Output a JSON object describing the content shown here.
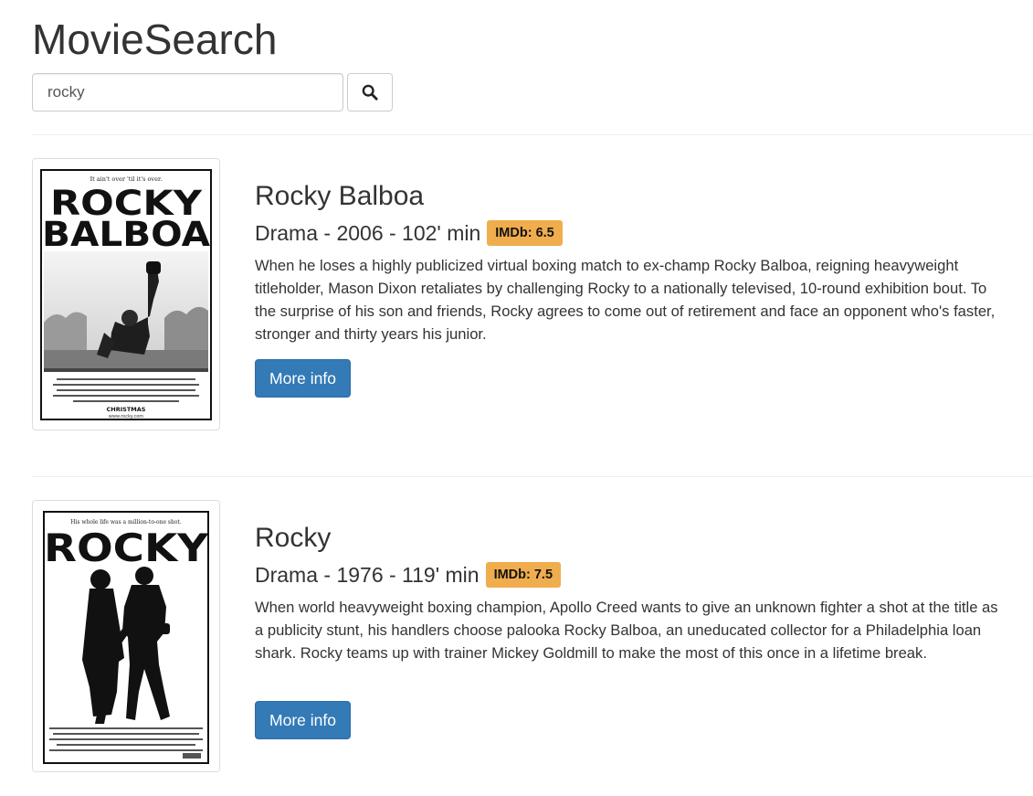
{
  "app": {
    "title": "MovieSearch"
  },
  "search": {
    "value": "rocky",
    "button_icon": "search-icon"
  },
  "movies": [
    {
      "title": "Rocky Balboa",
      "meta": "Drama - 2006 - 102' min",
      "imdb": "IMDb: 6.5",
      "plot": "When he loses a highly publicized virtual boxing match to ex-champ Rocky Balboa, reigning heavyweight titleholder, Mason Dixon retaliates by challenging Rocky to a nationally televised, 10-round exhibition bout. To the surprise of his son and friends, Rocky agrees to come out of retirement and face an opponent who's faster, stronger and thirty years his junior.",
      "more_info": "More info",
      "poster": {
        "tagline": "It ain't over 'til it's over.",
        "title_lines": [
          "ROCKY",
          "BALBOA"
        ],
        "release": "CHRISTMAS",
        "url": "www.rocky.com"
      }
    },
    {
      "title": "Rocky",
      "meta": "Drama - 1976 - 119' min",
      "imdb": "IMDb: 7.5",
      "plot": "When world heavyweight boxing champion, Apollo Creed wants to give an unknown fighter a shot at the title as a publicity stunt, his handlers choose palooka Rocky Balboa, an uneducated collector for a Philadelphia loan shark. Rocky teams up with trainer Mickey Goldmill to make the most of this once in a lifetime break.",
      "more_info": "More info",
      "poster": {
        "tagline": "His whole life was a million-to-one shot.",
        "title_lines": [
          "ROCKY"
        ]
      }
    }
  ],
  "colors": {
    "primary_button": "#337ab7",
    "imdb_badge": "#f0ad4e",
    "divider": "#eeeeee"
  }
}
